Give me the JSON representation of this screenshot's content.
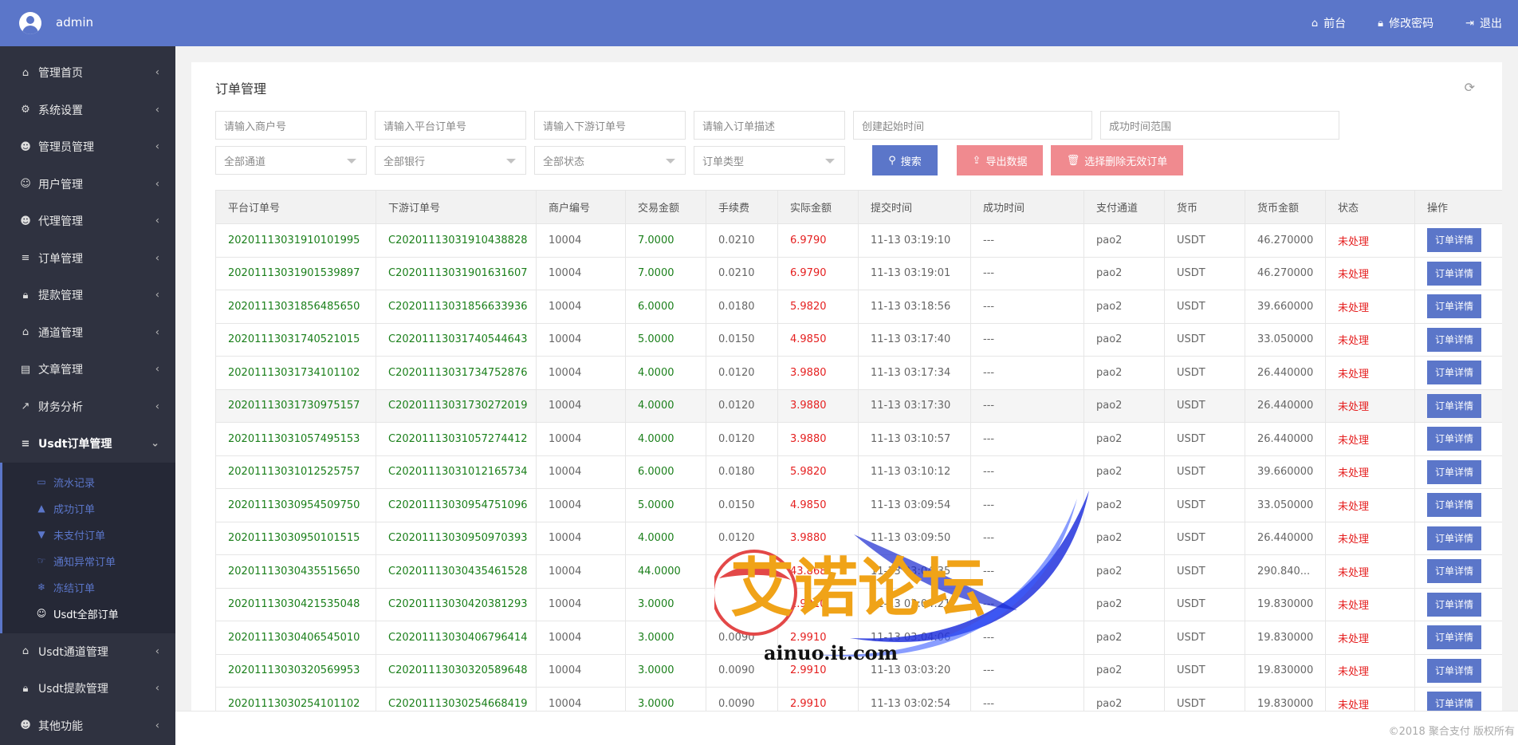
{
  "header": {
    "user": "admin",
    "nav": [
      {
        "label": "前台",
        "icon": "home-icon"
      },
      {
        "label": "修改密码",
        "icon": "lock-icon"
      },
      {
        "label": "退出",
        "icon": "logout-icon"
      }
    ]
  },
  "sidebar": {
    "items": [
      {
        "label": "管理首页",
        "icon": "home-icon"
      },
      {
        "label": "系统设置",
        "icon": "gears-icon"
      },
      {
        "label": "管理员管理",
        "icon": "user-circle-icon"
      },
      {
        "label": "用户管理",
        "icon": "users-icon"
      },
      {
        "label": "代理管理",
        "icon": "user-circle-icon"
      },
      {
        "label": "订单管理",
        "icon": "list-icon"
      },
      {
        "label": "提款管理",
        "icon": "lock-icon"
      },
      {
        "label": "通道管理",
        "icon": "bank-icon"
      },
      {
        "label": "文章管理",
        "icon": "book-icon"
      },
      {
        "label": "财务分析",
        "icon": "chart-icon"
      },
      {
        "label": "Usdt订单管理",
        "icon": "list-icon"
      }
    ],
    "submenu": [
      {
        "label": "流水记录",
        "icon": "ledger-icon"
      },
      {
        "label": "成功订单",
        "icon": "thumbs-up-icon"
      },
      {
        "label": "未支付订单",
        "icon": "thumbs-down-icon"
      },
      {
        "label": "通知异常订单",
        "icon": "hand-point-icon"
      },
      {
        "label": "冻结订单",
        "icon": "snowflake-icon"
      },
      {
        "label": "Usdt全部订单",
        "icon": "smile-icon"
      }
    ],
    "items_after": [
      {
        "label": "Usdt通道管理",
        "icon": "bank-icon"
      },
      {
        "label": "Usdt提款管理",
        "icon": "lock-icon"
      },
      {
        "label": "其他功能",
        "icon": "user-circle-icon"
      }
    ]
  },
  "page": {
    "title": "订单管理",
    "filters": {
      "merchant_placeholder": "请输入商户号",
      "platform_order_placeholder": "请输入平台订单号",
      "downstream_order_placeholder": "请输入下游订单号",
      "order_desc_placeholder": "请输入订单描述",
      "create_time_placeholder": "创建起始时间",
      "success_time_placeholder": "成功时间范围",
      "channel": "全部通道",
      "bank": "全部银行",
      "status": "全部状态",
      "order_type": "订单类型"
    },
    "buttons": {
      "search": "搜索",
      "export": "导出数据",
      "delete_invalid": "选择删除无效订单"
    }
  },
  "table": {
    "columns": [
      "平台订单号",
      "下游订单号",
      "商户编号",
      "交易金额",
      "手续费",
      "实际金额",
      "提交时间",
      "成功时间",
      "支付通道",
      "货币",
      "货币金额",
      "状态",
      "操作"
    ],
    "action_label": "订单详情",
    "rows": [
      [
        "20201113031910101995",
        "C20201113031910438828",
        "10004",
        "7.0000",
        "0.0210",
        "6.9790",
        "11-13 03:19:10",
        "---",
        "pao2",
        "USDT",
        "46.270000",
        "未处理"
      ],
      [
        "20201113031901539897",
        "C20201113031901631607",
        "10004",
        "7.0000",
        "0.0210",
        "6.9790",
        "11-13 03:19:01",
        "---",
        "pao2",
        "USDT",
        "46.270000",
        "未处理"
      ],
      [
        "20201113031856485650",
        "C20201113031856633936",
        "10004",
        "6.0000",
        "0.0180",
        "5.9820",
        "11-13 03:18:56",
        "---",
        "pao2",
        "USDT",
        "39.660000",
        "未处理"
      ],
      [
        "20201113031740521015",
        "C20201113031740544643",
        "10004",
        "5.0000",
        "0.0150",
        "4.9850",
        "11-13 03:17:40",
        "---",
        "pao2",
        "USDT",
        "33.050000",
        "未处理"
      ],
      [
        "20201113031734101102",
        "C20201113031734752876",
        "10004",
        "4.0000",
        "0.0120",
        "3.9880",
        "11-13 03:17:34",
        "---",
        "pao2",
        "USDT",
        "26.440000",
        "未处理"
      ],
      [
        "20201113031730975157",
        "C20201113031730272019",
        "10004",
        "4.0000",
        "0.0120",
        "3.9880",
        "11-13 03:17:30",
        "---",
        "pao2",
        "USDT",
        "26.440000",
        "未处理"
      ],
      [
        "20201113031057495153",
        "C20201113031057274412",
        "10004",
        "4.0000",
        "0.0120",
        "3.9880",
        "11-13 03:10:57",
        "---",
        "pao2",
        "USDT",
        "26.440000",
        "未处理"
      ],
      [
        "20201113031012525757",
        "C20201113031012165734",
        "10004",
        "6.0000",
        "0.0180",
        "5.9820",
        "11-13 03:10:12",
        "---",
        "pao2",
        "USDT",
        "39.660000",
        "未处理"
      ],
      [
        "20201113030954509750",
        "C20201113030954751096",
        "10004",
        "5.0000",
        "0.0150",
        "4.9850",
        "11-13 03:09:54",
        "---",
        "pao2",
        "USDT",
        "33.050000",
        "未处理"
      ],
      [
        "20201113030950101515",
        "C20201113030950970393",
        "10004",
        "4.0000",
        "0.0120",
        "3.9880",
        "11-13 03:09:50",
        "---",
        "pao2",
        "USDT",
        "26.440000",
        "未处理"
      ],
      [
        "20201113030435515650",
        "C20201113030435461528",
        "10004",
        "44.0000",
        "0.132",
        "43.868",
        "11-13 03:04:35",
        "---",
        "pao2",
        "USDT",
        "290.840...",
        "未处理"
      ],
      [
        "20201113030421535048",
        "C20201113030420381293",
        "10004",
        "3.0000",
        "0.0090",
        "2.9910",
        "11-13 03:04:21",
        "---",
        "pao2",
        "USDT",
        "19.830000",
        "未处理"
      ],
      [
        "20201113030406545010",
        "C20201113030406796414",
        "10004",
        "3.0000",
        "0.0090",
        "2.9910",
        "11-13 03:04:06",
        "---",
        "pao2",
        "USDT",
        "19.830000",
        "未处理"
      ],
      [
        "20201113030320569953",
        "C20201113030320589648",
        "10004",
        "3.0000",
        "0.0090",
        "2.9910",
        "11-13 03:03:20",
        "---",
        "pao2",
        "USDT",
        "19.830000",
        "未处理"
      ],
      [
        "20201113030254101102",
        "C20201113030254668419",
        "10004",
        "3.0000",
        "0.0090",
        "2.9910",
        "11-13 03:02:54",
        "---",
        "pao2",
        "USDT",
        "19.830000",
        "未处理"
      ]
    ]
  },
  "footer": {
    "copyright": "©2018 聚合支付 版权所有"
  },
  "watermark": {
    "title": "艾诺论坛",
    "url": "ainuo.it.com"
  },
  "colors": {
    "primary": "#5b76c9",
    "sidebar": "#2f3240",
    "danger": "#e52020",
    "success": "#1a7f1a",
    "pink": "#f08a8f"
  }
}
